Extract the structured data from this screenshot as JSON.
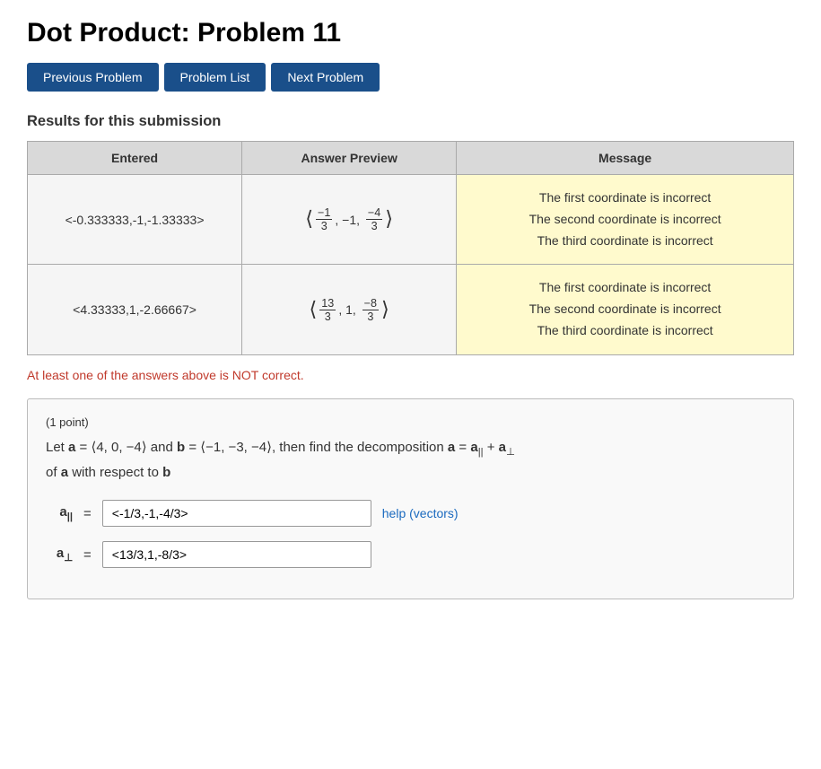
{
  "page": {
    "title": "Dot Product: Problem 11"
  },
  "nav": {
    "prev_label": "Previous Problem",
    "list_label": "Problem List",
    "next_label": "Next Problem"
  },
  "results": {
    "heading": "Results for this submission",
    "table": {
      "headers": [
        "Entered",
        "Answer Preview",
        "Message"
      ],
      "rows": [
        {
          "entered": "<-0.333333,-1,-1.33333>",
          "preview_html": "⟨−1/3, −1, −4/3⟩",
          "messages": [
            "The first coordinate is incorrect",
            "The second coordinate is incorrect",
            "The third coordinate is incorrect"
          ]
        },
        {
          "entered": "<4.33333,1,-2.66667>",
          "preview_html": "⟨13/3, 1, −8/3⟩",
          "messages": [
            "The first coordinate is incorrect",
            "The second coordinate is incorrect",
            "The third coordinate is incorrect"
          ]
        }
      ]
    },
    "not_correct": "At least one of the answers above is NOT correct."
  },
  "problem": {
    "points": "(1 point)",
    "statement_parts": {
      "intro": "Let a = ⟨4, 0, −4⟩ and b = ⟨−1, −3, −4⟩, then find the decomposition a = a∥ + a⊥",
      "outro": "of a with respect to b"
    },
    "answers": [
      {
        "label": "a∥",
        "subscript": "||",
        "value": "<-1/3,-1,-4/3>",
        "help_label": "help (vectors)",
        "show_help": true
      },
      {
        "label": "a⊥",
        "subscript": "⊥",
        "value": "<13/3,1,-8/3>",
        "show_help": false
      }
    ]
  }
}
